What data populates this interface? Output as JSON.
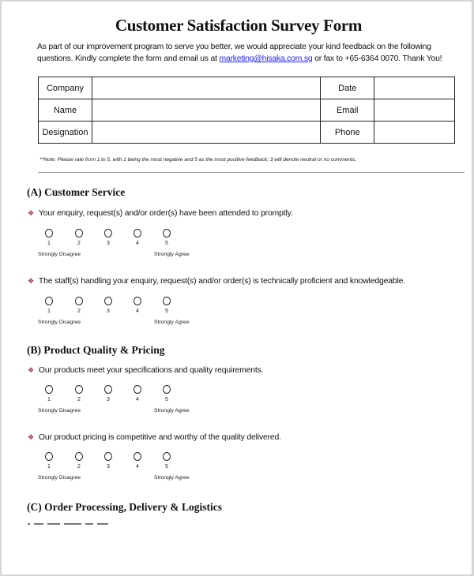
{
  "title": "Customer Satisfaction Survey Form",
  "intro": {
    "text_before": "As part of our improvement program to serve you better, we would appreciate your kind feedback on the following questions.  Kindly complete the form and email us at ",
    "email": "marketing@hisaka.com.sg",
    "text_after": " or fax to +65-6364 0070. Thank You!"
  },
  "info_table": {
    "rows": [
      {
        "left_label": "Company",
        "left_value": "",
        "right_label": "Date",
        "right_value": ""
      },
      {
        "left_label": "Name",
        "left_value": "",
        "right_label": "Email",
        "right_value": ""
      },
      {
        "left_label": "Designation",
        "left_value": "",
        "right_label": "Phone",
        "right_value": ""
      }
    ]
  },
  "note": "**Note: Please rate from 1 to 5, with 1 being the most negative and 5 as the most positive feedback; 3 will denote neutral or no comments.",
  "scale": {
    "options": [
      "1",
      "2",
      "3",
      "4",
      "5"
    ],
    "low_label": "Strongly Disagree",
    "high_label": "Strongly Agree",
    "bullet_icon": "diamond-bullet",
    "bullet_color": "#a03040"
  },
  "sections": [
    {
      "title": "(A) Customer Service",
      "questions": [
        "Your enquiry, request(s) and/or order(s) have been attended to promptly.",
        "The staff(s) handling your enquiry, request(s) and/or order(s) is technically proficient and knowledgeable."
      ]
    },
    {
      "title": "(B) Product Quality & Pricing",
      "questions": [
        "Our products meet your specifications and quality requirements.",
        "Our product pricing is competitive and worthy of the quality delivered."
      ]
    },
    {
      "title": "(C) Order Processing, Delivery & Logistics",
      "questions": []
    }
  ]
}
